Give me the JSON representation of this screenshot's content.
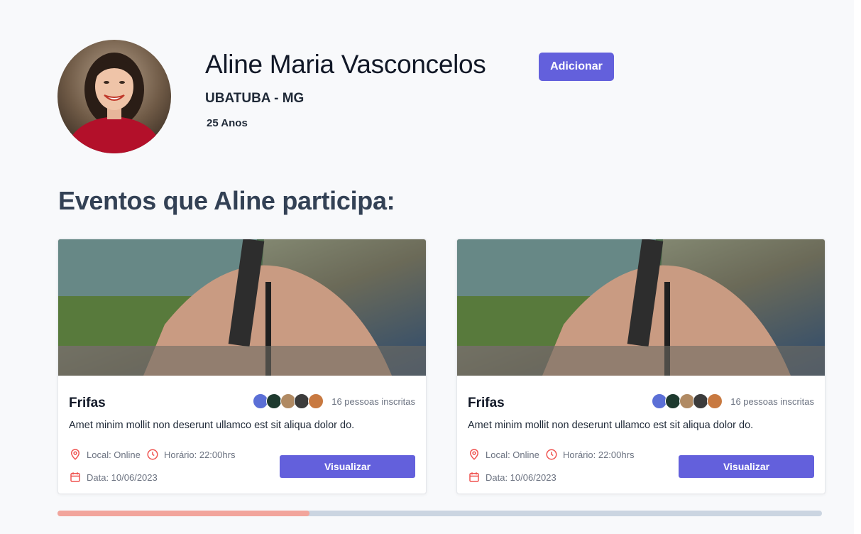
{
  "profile": {
    "name": "Aline Maria Vasconcelos",
    "location": "UBATUBA - MG",
    "age": "25 Anos",
    "add_button": "Adicionar",
    "avatar_icon": "profile-photo"
  },
  "section_title": "Eventos que Aline participa:",
  "events": [
    {
      "title": "Frifas",
      "subscribers": "16 pessoas inscritas",
      "description": "Amet minim mollit non deserunt ullamco est sit aliqua dolor do.",
      "local": "Local: Online",
      "time": "Horário: 22:00hrs",
      "date": "Data: 10/06/2023",
      "button": "Visualizar"
    },
    {
      "title": "Frifas",
      "subscribers": "16 pessoas inscritas",
      "description": "Amet minim mollit non deserunt ullamco est sit aliqua dolor do.",
      "local": "Local: Online",
      "time": "Horário: 22:00hrs",
      "date": "Data: 10/06/2023",
      "button": "Visualizar"
    }
  ],
  "colors": {
    "accent": "#6360dc",
    "icon_red": "#ef5350",
    "scroll_thumb": "#f2a59c",
    "scroll_track": "#cbd5e1"
  },
  "scroll_progress": 0.33
}
